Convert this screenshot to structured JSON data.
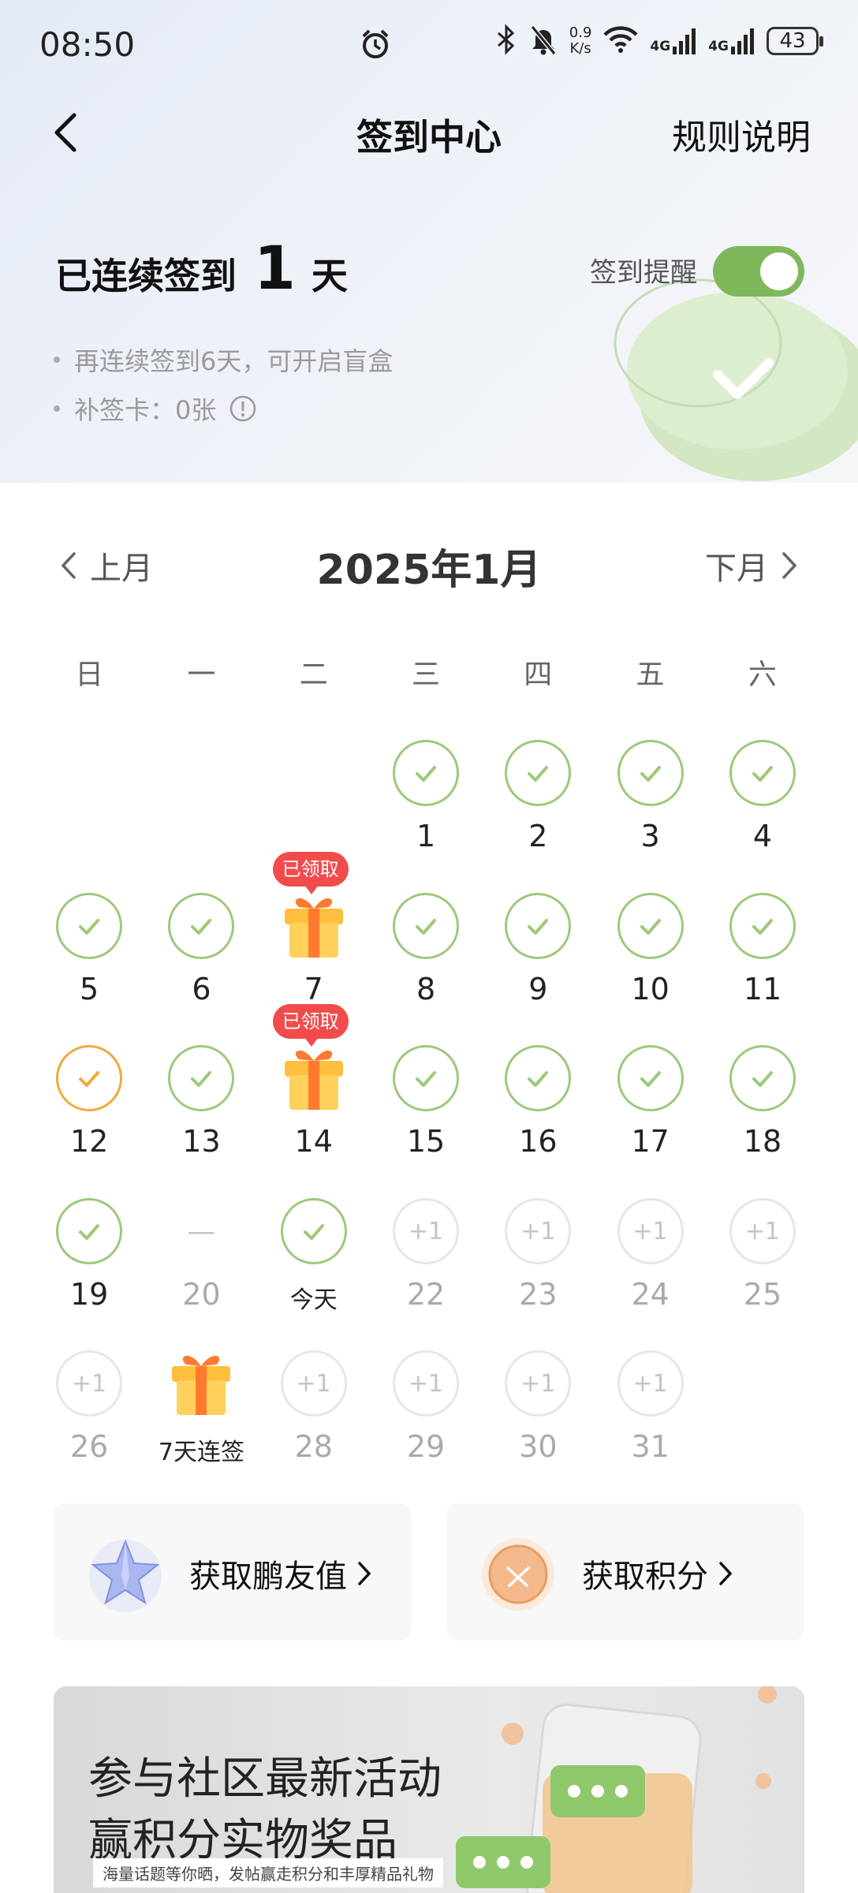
{
  "status_bar": {
    "time": "08:50",
    "speed_value": "0.9",
    "speed_unit": "K/s",
    "net1": "4G",
    "net2": "4G",
    "battery": "43"
  },
  "nav": {
    "title": "签到中心",
    "rule_label": "规则说明"
  },
  "streak": {
    "prefix": "已连续签到",
    "count": "1",
    "suffix": "天"
  },
  "reminder": {
    "label": "签到提醒",
    "enabled": true
  },
  "info": {
    "line1": "再连续签到6天，可开启盲盒",
    "line2": "补签卡：0张"
  },
  "calendar": {
    "prev_label": "上月",
    "next_label": "下月",
    "month_title": "2025年1月",
    "weekdays": [
      "日",
      "一",
      "二",
      "三",
      "四",
      "五",
      "六"
    ],
    "weeks": [
      [
        null,
        null,
        null,
        {
          "label": "1",
          "state": "checked"
        },
        {
          "label": "2",
          "state": "checked"
        },
        {
          "label": "3",
          "state": "checked"
        },
        {
          "label": "4",
          "state": "checked"
        }
      ],
      [
        {
          "label": "5",
          "state": "checked"
        },
        {
          "label": "6",
          "state": "checked"
        },
        {
          "label": "7",
          "state": "gift",
          "badge": "已领取"
        },
        {
          "label": "8",
          "state": "checked"
        },
        {
          "label": "9",
          "state": "checked"
        },
        {
          "label": "10",
          "state": "checked"
        },
        {
          "label": "11",
          "state": "checked"
        }
      ],
      [
        {
          "label": "12",
          "state": "checked-orange"
        },
        {
          "label": "13",
          "state": "checked"
        },
        {
          "label": "14",
          "state": "gift",
          "badge": "已领取"
        },
        {
          "label": "15",
          "state": "checked"
        },
        {
          "label": "16",
          "state": "checked"
        },
        {
          "label": "17",
          "state": "checked"
        },
        {
          "label": "18",
          "state": "checked"
        }
      ],
      [
        {
          "label": "19",
          "state": "checked"
        },
        {
          "label": "20",
          "state": "missed",
          "mark": "—"
        },
        {
          "label": "今天",
          "state": "checked",
          "small": true
        },
        {
          "label": "22",
          "state": "future",
          "mark": "+1"
        },
        {
          "label": "23",
          "state": "future",
          "mark": "+1"
        },
        {
          "label": "24",
          "state": "future",
          "mark": "+1"
        },
        {
          "label": "25",
          "state": "future",
          "mark": "+1"
        }
      ],
      [
        {
          "label": "26",
          "state": "future",
          "mark": "+1"
        },
        {
          "label": "7天连签",
          "state": "gift-future",
          "small": true
        },
        {
          "label": "28",
          "state": "future",
          "mark": "+1"
        },
        {
          "label": "29",
          "state": "future",
          "mark": "+1"
        },
        {
          "label": "30",
          "state": "future",
          "mark": "+1"
        },
        {
          "label": "31",
          "state": "future",
          "mark": "+1"
        },
        null
      ]
    ]
  },
  "cards": {
    "friend_value": "获取鹏友值",
    "points": "获取积分"
  },
  "banner": {
    "line1": "参与社区最新活动",
    "line2": "赢积分实物奖品",
    "tag": "海量话题等你晒，发帖赢走积分和丰厚精品礼物"
  },
  "colors": {
    "accent_green": "#9cc97a",
    "toggle_green": "#7fb85a",
    "badge_red": "#f14b4b",
    "today_orange": "#f2a93b"
  }
}
